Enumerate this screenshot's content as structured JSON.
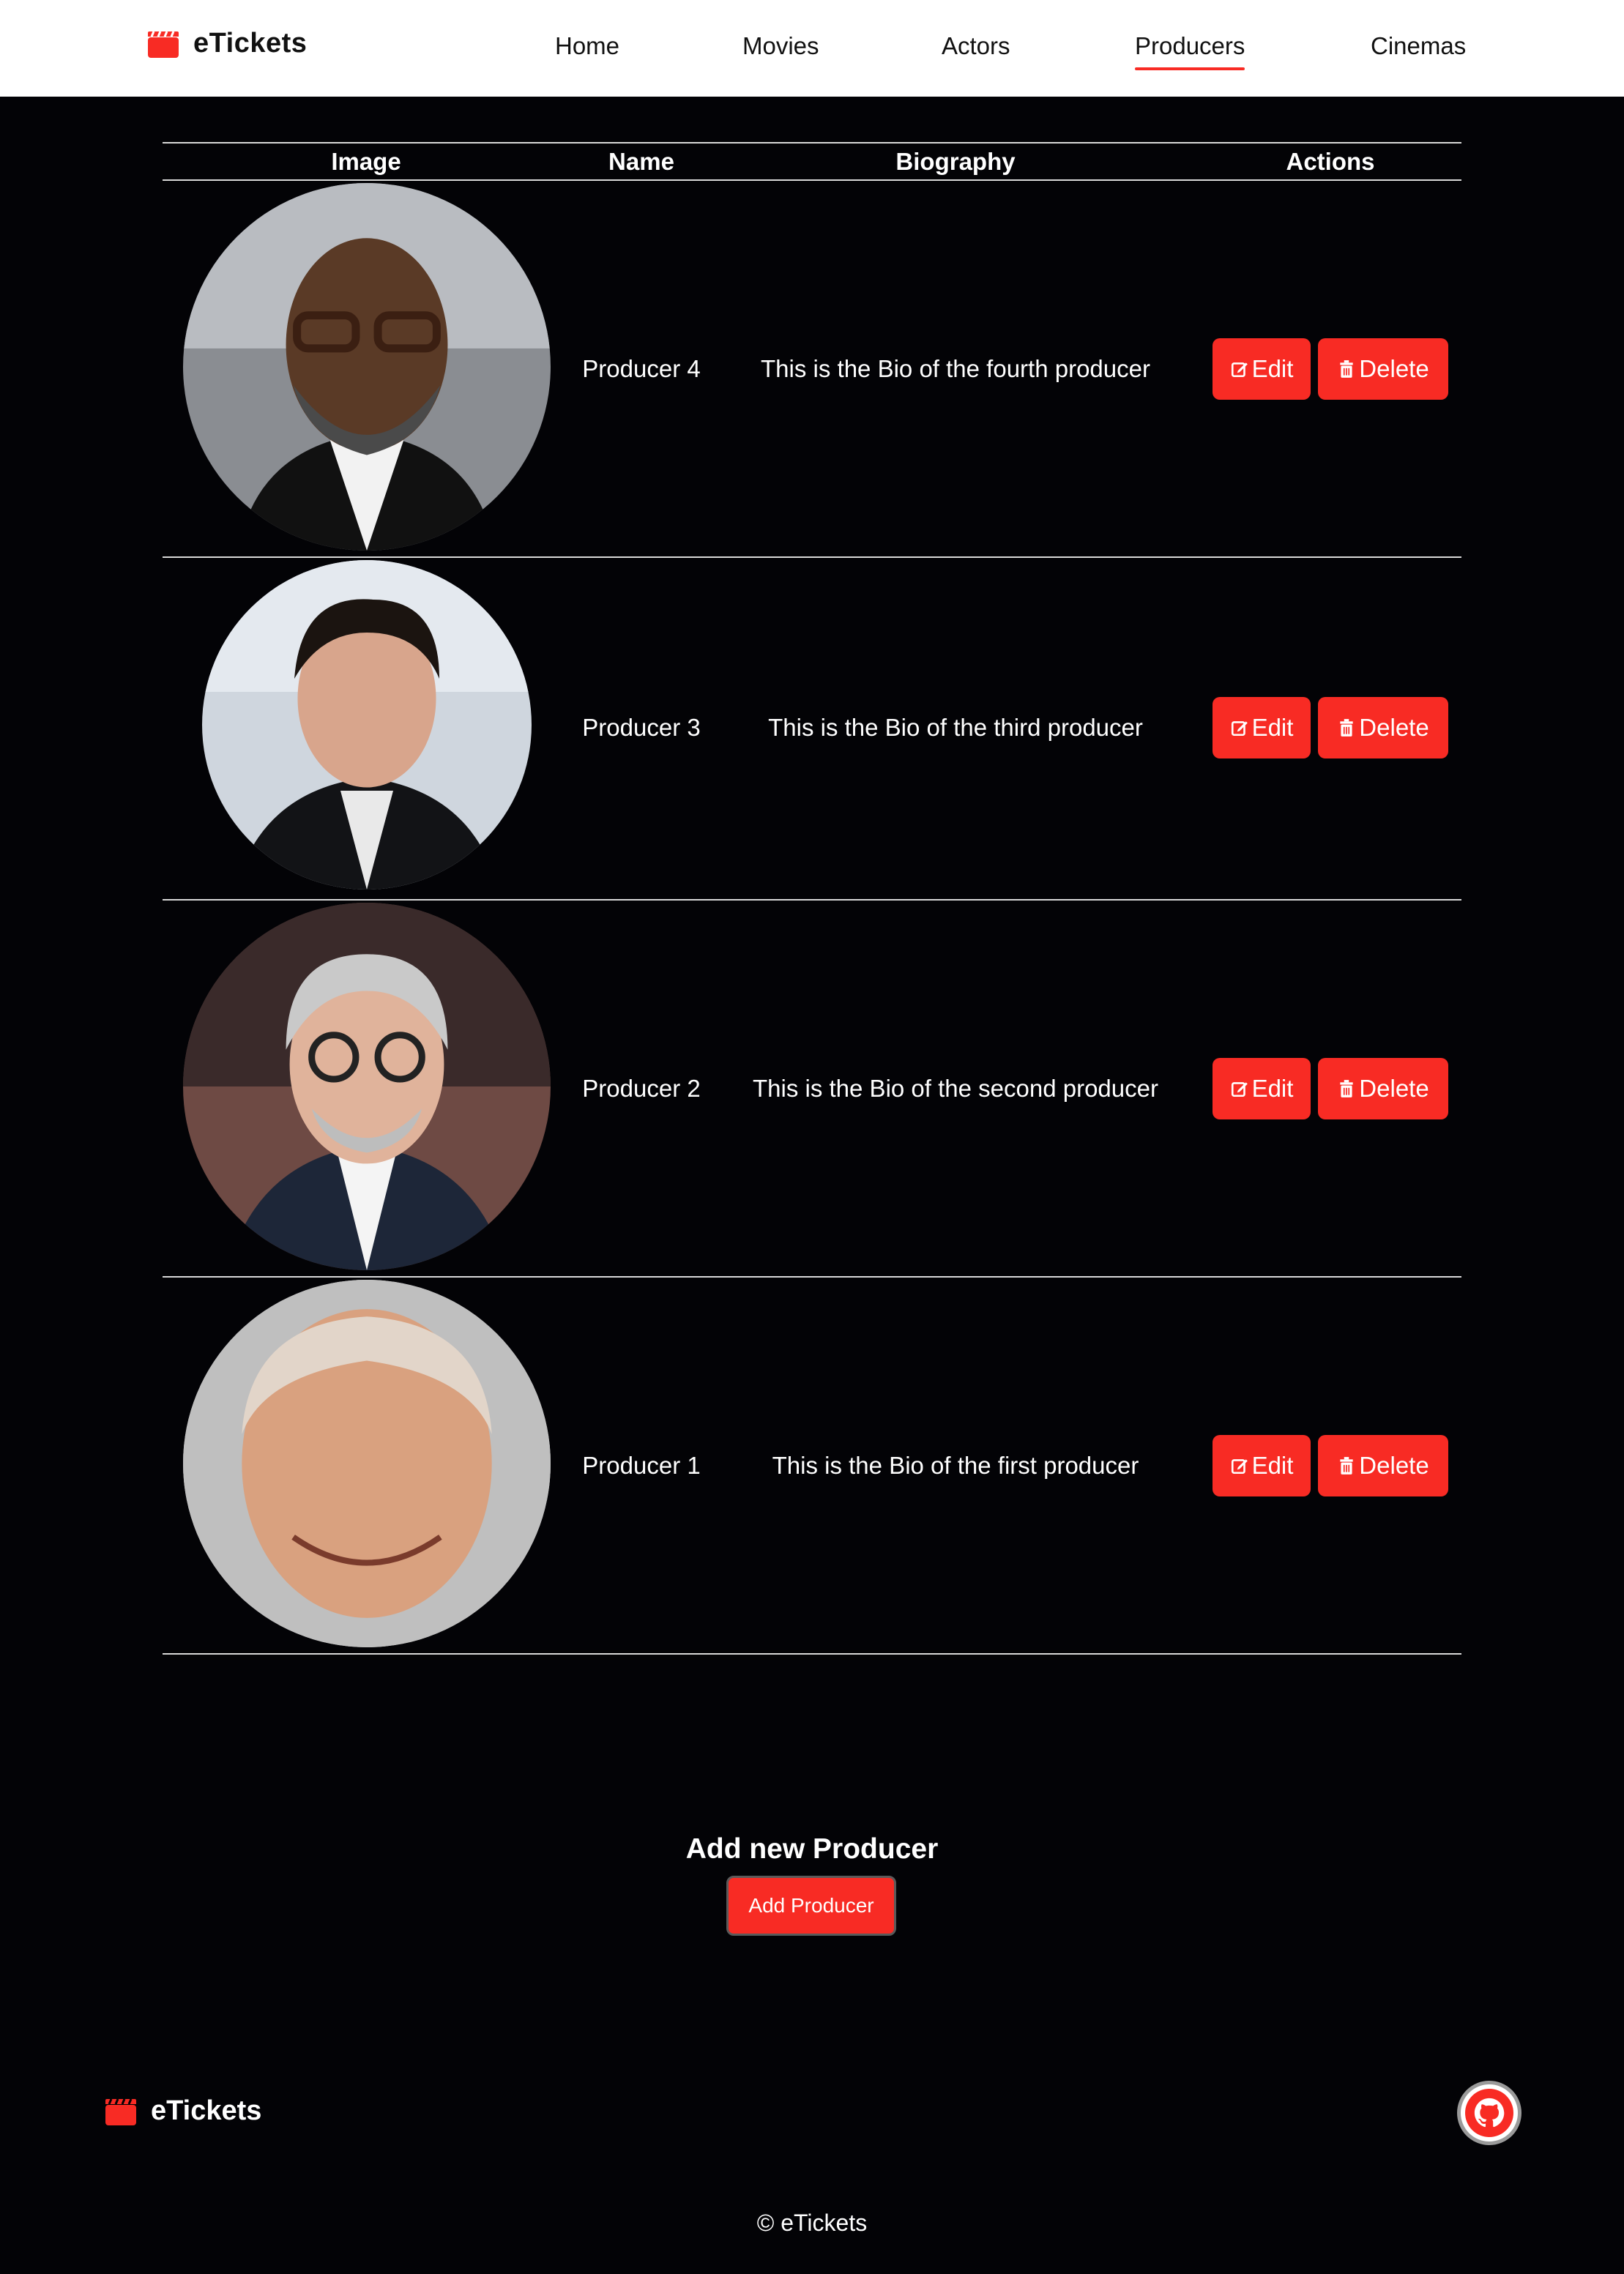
{
  "brand": {
    "name": "eTickets",
    "accent_color": "#f82b24"
  },
  "nav": {
    "items": [
      {
        "label": "Home"
      },
      {
        "label": "Movies"
      },
      {
        "label": "Actors"
      },
      {
        "label": "Producers",
        "active": true
      },
      {
        "label": "Cinemas"
      }
    ]
  },
  "table": {
    "headers": {
      "image": "Image",
      "name": "Name",
      "biography": "Biography",
      "actions": "Actions"
    },
    "rows": [
      {
        "name": "Producer 4",
        "bio": "This is the Bio of the fourth producer",
        "edit_label": "Edit",
        "delete_label": "Delete",
        "image": "producer-photo"
      },
      {
        "name": "Producer 3",
        "bio": "This is the Bio of the third producer",
        "edit_label": "Edit",
        "delete_label": "Delete",
        "image": "producer-photo"
      },
      {
        "name": "Producer 2",
        "bio": "This is the Bio of the second producer",
        "edit_label": "Edit",
        "delete_label": "Delete",
        "image": "producer-photo"
      },
      {
        "name": "Producer 1",
        "bio": "This is the Bio of the first producer",
        "edit_label": "Edit",
        "delete_label": "Delete",
        "image": "producer-photo"
      }
    ]
  },
  "add_section": {
    "title": "Add new Producer",
    "button_label": "Add Producer"
  },
  "footer": {
    "brand": "eTickets",
    "copyright": "© eTickets",
    "github_icon": "github-icon"
  }
}
